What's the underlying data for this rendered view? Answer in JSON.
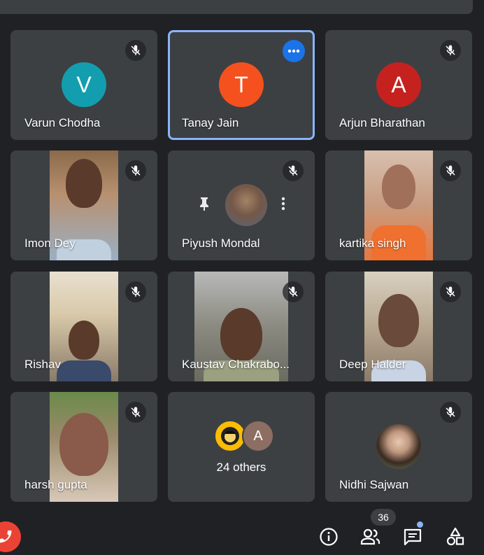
{
  "participants": [
    {
      "name": "Varun Chodha",
      "initial": "V",
      "avatar_color": "#129eaf"
    },
    {
      "name": "Tanay Jain",
      "initial": "T",
      "avatar_color": "#f4511e"
    },
    {
      "name": "Arjun Bharathan",
      "initial": "A",
      "avatar_color": "#c5221f"
    },
    {
      "name": "Imon Dey"
    },
    {
      "name": "Piyush Mondal"
    },
    {
      "name": "kartika singh"
    },
    {
      "name": "Rishav"
    },
    {
      "name": "Kaustav Chakrabo..."
    },
    {
      "name": "Deep Halder"
    },
    {
      "name": "harsh gupta"
    },
    {
      "name": "Nidhi Sajwan"
    }
  ],
  "others": {
    "label": "24 others",
    "avatar_initial": "A"
  },
  "toolbar": {
    "participant_count": "36"
  },
  "colors": {
    "background": "#202124",
    "tile": "#3c4043",
    "active_border": "#8ab4f8",
    "end_call": "#ea4335",
    "accent": "#1a73e8"
  }
}
